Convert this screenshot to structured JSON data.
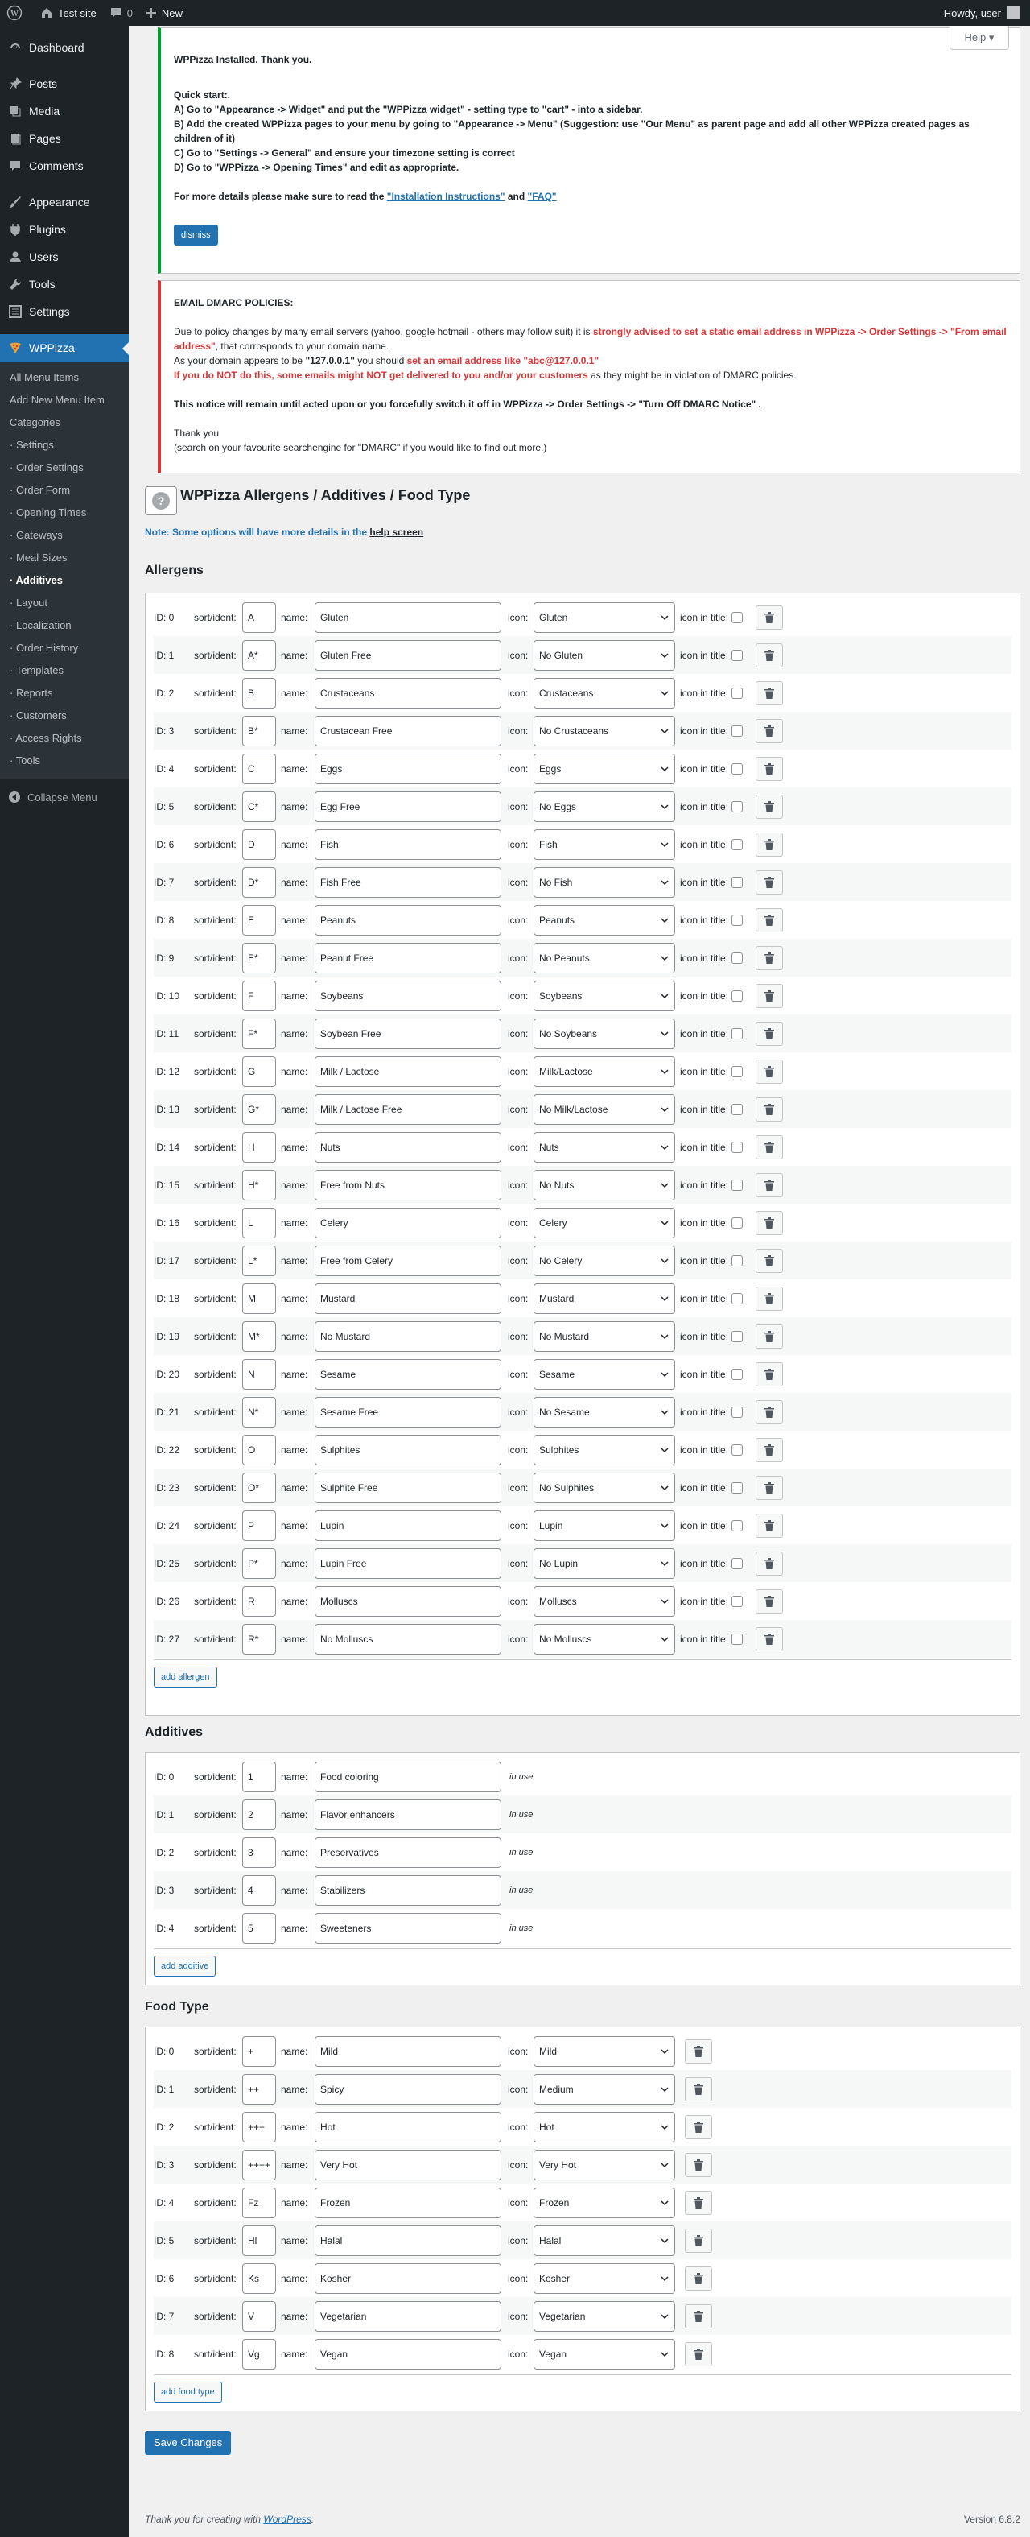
{
  "adminbar": {
    "site_name": "Test site",
    "comments_count": "0",
    "new_label": "New",
    "howdy": "Howdy, user"
  },
  "menu": {
    "dashboard": "Dashboard",
    "posts": "Posts",
    "media": "Media",
    "pages": "Pages",
    "comments": "Comments",
    "appearance": "Appearance",
    "plugins": "Plugins",
    "users": "Users",
    "tools": "Tools",
    "settings": "Settings",
    "wppizza": "WPPizza",
    "sub": [
      "All Menu Items",
      "Add New Menu Item",
      "Categories",
      "· Settings",
      "· Order Settings",
      "· Order Form",
      "· Opening Times",
      "· Gateways",
      "· Meal Sizes",
      "· Additives",
      "· Layout",
      "· Localization",
      "· Order History",
      "· Templates",
      "· Reports",
      "· Customers",
      "· Access Rights",
      "· Tools"
    ],
    "collapse": "Collapse Menu"
  },
  "help_tab": "Help",
  "notice1": {
    "title": "WPPizza Installed. Thank you.",
    "quick": "Quick start:.",
    "a": "A) Go to \"Appearance -> Widget\" and put the \"WPPizza widget\" - setting type to \"cart\" - into a sidebar.",
    "b": "B) Add the created WPPizza pages to your menu by going to \"Appearance -> Menu\" (Suggestion: use \"Our Menu\" as parent page and add all other WPPizza created pages as children of it)",
    "c": "C) Go to \"Settings -> General\" and ensure your timezone setting is correct",
    "d": "D) Go to \"WPPizza -> Opening Times\" and edit as appropriate.",
    "more": "For more details please make sure to read the",
    "link1": "\"Installation Instructions\"",
    "and": "and",
    "link2": "\"FAQ\"",
    "dismiss": "dismiss"
  },
  "notice2": {
    "title": "EMAIL DMARC POLICIES:",
    "p1a": "Due to policy changes by many email servers (yahoo, google hotmail - others may follow suit) it is",
    "p1b": "strongly advised to set a static email address in WPPizza -> Order Settings -> \"From email address\"",
    "p1c": ", that corrosponds to your domain name.",
    "p2a": "As your domain appears to be",
    "p2b": "\"127.0.0.1\"",
    "p2c": "you should",
    "p2d": "set an email address like \"abc@127.0.0.1\"",
    "p3a": "If you do NOT do this, some emails might NOT get delivered to you and/or your customers",
    "p3b": "as they might be in violation of DMARC policies.",
    "p4": "This notice will remain until acted upon or you forcefully switch it off in WPPizza -> Order Settings -> \"Turn Off DMARC Notice\" .",
    "p5": "Thank you",
    "p6": "(search on your favourite searchengine for \"DMARC\" if you would like to find out more.)"
  },
  "page_title": "WPPizza Allergens / Additives / Food Type",
  "note": "Note: Some options will have more details in the",
  "note_link": "help screen",
  "labels": {
    "sort": "sort/ident:",
    "name": "name:",
    "icon": "icon:",
    "icon_in_title": "icon in title:",
    "in_use": "in use"
  },
  "allergens": {
    "title": "Allergens",
    "add": "add allergen",
    "items": [
      {
        "id": "ID: 0",
        "sort": "A",
        "name": "Gluten",
        "icon": "Gluten"
      },
      {
        "id": "ID: 1",
        "sort": "A*",
        "name": "Gluten Free",
        "icon": "No Gluten"
      },
      {
        "id": "ID: 2",
        "sort": "B",
        "name": "Crustaceans",
        "icon": "Crustaceans"
      },
      {
        "id": "ID: 3",
        "sort": "B*",
        "name": "Crustacean Free",
        "icon": "No Crustaceans"
      },
      {
        "id": "ID: 4",
        "sort": "C",
        "name": "Eggs",
        "icon": "Eggs"
      },
      {
        "id": "ID: 5",
        "sort": "C*",
        "name": "Egg Free",
        "icon": "No Eggs"
      },
      {
        "id": "ID: 6",
        "sort": "D",
        "name": "Fish",
        "icon": "Fish"
      },
      {
        "id": "ID: 7",
        "sort": "D*",
        "name": "Fish Free",
        "icon": "No Fish"
      },
      {
        "id": "ID: 8",
        "sort": "E",
        "name": "Peanuts",
        "icon": "Peanuts"
      },
      {
        "id": "ID: 9",
        "sort": "E*",
        "name": "Peanut Free",
        "icon": "No Peanuts"
      },
      {
        "id": "ID: 10",
        "sort": "F",
        "name": "Soybeans",
        "icon": "Soybeans"
      },
      {
        "id": "ID: 11",
        "sort": "F*",
        "name": "Soybean Free",
        "icon": "No Soybeans"
      },
      {
        "id": "ID: 12",
        "sort": "G",
        "name": "Milk / Lactose",
        "icon": "Milk/Lactose"
      },
      {
        "id": "ID: 13",
        "sort": "G*",
        "name": "Milk / Lactose Free",
        "icon": "No Milk/Lactose"
      },
      {
        "id": "ID: 14",
        "sort": "H",
        "name": "Nuts",
        "icon": "Nuts"
      },
      {
        "id": "ID: 15",
        "sort": "H*",
        "name": "Free from Nuts",
        "icon": "No Nuts"
      },
      {
        "id": "ID: 16",
        "sort": "L",
        "name": "Celery",
        "icon": "Celery"
      },
      {
        "id": "ID: 17",
        "sort": "L*",
        "name": "Free from Celery",
        "icon": "No Celery"
      },
      {
        "id": "ID: 18",
        "sort": "M",
        "name": "Mustard",
        "icon": "Mustard"
      },
      {
        "id": "ID: 19",
        "sort": "M*",
        "name": "No Mustard",
        "icon": "No Mustard"
      },
      {
        "id": "ID: 20",
        "sort": "N",
        "name": "Sesame",
        "icon": "Sesame"
      },
      {
        "id": "ID: 21",
        "sort": "N*",
        "name": "Sesame Free",
        "icon": "No Sesame"
      },
      {
        "id": "ID: 22",
        "sort": "O",
        "name": "Sulphites",
        "icon": "Sulphites"
      },
      {
        "id": "ID: 23",
        "sort": "O*",
        "name": "Sulphite Free",
        "icon": "No Sulphites"
      },
      {
        "id": "ID: 24",
        "sort": "P",
        "name": "Lupin",
        "icon": "Lupin"
      },
      {
        "id": "ID: 25",
        "sort": "P*",
        "name": "Lupin Free",
        "icon": "No Lupin"
      },
      {
        "id": "ID: 26",
        "sort": "R",
        "name": "Molluscs",
        "icon": "Molluscs"
      },
      {
        "id": "ID: 27",
        "sort": "R*",
        "name": "No Molluscs",
        "icon": "No Molluscs"
      }
    ]
  },
  "additives": {
    "title": "Additives",
    "add": "add additive",
    "items": [
      {
        "id": "ID: 0",
        "sort": "1",
        "name": "Food coloring"
      },
      {
        "id": "ID: 1",
        "sort": "2",
        "name": "Flavor enhancers"
      },
      {
        "id": "ID: 2",
        "sort": "3",
        "name": "Preservatives"
      },
      {
        "id": "ID: 3",
        "sort": "4",
        "name": "Stabilizers"
      },
      {
        "id": "ID: 4",
        "sort": "5",
        "name": "Sweeteners"
      }
    ]
  },
  "foodtype": {
    "title": "Food Type",
    "add": "add food type",
    "items": [
      {
        "id": "ID: 0",
        "sort": "+",
        "name": "Mild",
        "icon": "Mild"
      },
      {
        "id": "ID: 1",
        "sort": "++",
        "name": "Spicy",
        "icon": "Medium"
      },
      {
        "id": "ID: 2",
        "sort": "+++",
        "name": "Hot",
        "icon": "Hot"
      },
      {
        "id": "ID: 3",
        "sort": "++++",
        "name": "Very Hot",
        "icon": "Very Hot"
      },
      {
        "id": "ID: 4",
        "sort": "Fz",
        "name": "Frozen",
        "icon": "Frozen"
      },
      {
        "id": "ID: 5",
        "sort": "Hl",
        "name": "Halal",
        "icon": "Halal"
      },
      {
        "id": "ID: 6",
        "sort": "Ks",
        "name": "Kosher",
        "icon": "Kosher"
      },
      {
        "id": "ID: 7",
        "sort": "V",
        "name": "Vegetarian",
        "icon": "Vegetarian"
      },
      {
        "id": "ID: 8",
        "sort": "Vg",
        "name": "Vegan",
        "icon": "Vegan"
      }
    ]
  },
  "save": "Save Changes",
  "footer": {
    "thanks": "Thank you for creating with",
    "wp": "WordPress",
    "version": "Version 6.8.2"
  },
  "colors": {
    "accent": "#2271b1",
    "sidebar": "#1d2327",
    "success": "#00a32a",
    "error": "#d63638"
  }
}
